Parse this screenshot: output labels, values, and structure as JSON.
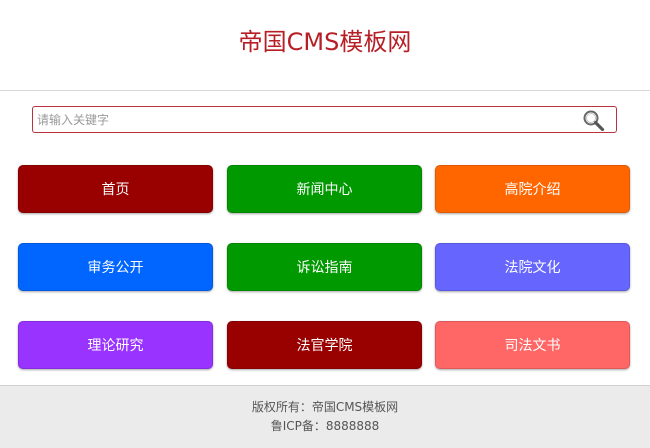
{
  "header": {
    "site_title": "帝国CMS模板网"
  },
  "search": {
    "placeholder": "请输入关键字",
    "value": "",
    "button_icon": "search-icon"
  },
  "nav": {
    "items": [
      {
        "label": "首页",
        "color": "#990000"
      },
      {
        "label": "新闻中心",
        "color": "#009900"
      },
      {
        "label": "高院介绍",
        "color": "#ff6600"
      },
      {
        "label": "审务公开",
        "color": "#0066ff"
      },
      {
        "label": "诉讼指南",
        "color": "#009900"
      },
      {
        "label": "法院文化",
        "color": "#6666ff"
      },
      {
        "label": "理论研究",
        "color": "#9933ff"
      },
      {
        "label": "法官学院",
        "color": "#990000"
      },
      {
        "label": "司法文书",
        "color": "#ff6666"
      }
    ]
  },
  "footer": {
    "copyright": "版权所有：帝国CMS模板网",
    "icp": "鲁ICP备：8888888"
  },
  "colors": {
    "title": "#b61f26",
    "search_border": "#b83240",
    "footer_bg": "#ebebeb"
  }
}
